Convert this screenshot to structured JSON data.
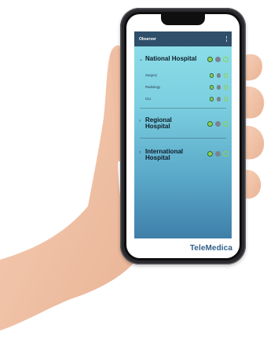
{
  "app": {
    "title": "Observer",
    "brand": "TeleMedica",
    "colors": {
      "header": "#2f4f6a",
      "ok": "#8fd24a",
      "neutral": "#7a8290",
      "brand": "#2f5f8a"
    }
  },
  "groups": [
    {
      "name": "National Hospital",
      "expanded": true,
      "chevron": "⌄",
      "status": [
        "green",
        "gray",
        "hollow"
      ],
      "children": [
        {
          "name": "Surgery",
          "status": [
            "green",
            "gray",
            "hollow"
          ]
        },
        {
          "name": "Radiology",
          "status": [
            "green",
            "gray",
            "hollow"
          ]
        },
        {
          "name": "ICU",
          "status": [
            "green",
            "gray",
            "hollow"
          ]
        }
      ]
    },
    {
      "name": "Regional Hospital",
      "line1": "Regional",
      "line2": "Hospital",
      "expanded": false,
      "chevron": "›",
      "status": [
        "green",
        "gray",
        "hollow"
      ]
    },
    {
      "name": "International Hospital",
      "line1": "International",
      "line2": "Hospital",
      "expanded": false,
      "chevron": "›",
      "status": [
        "green",
        "gray",
        "hollow"
      ]
    }
  ],
  "icons": {
    "menu": "more-vert-icon",
    "expand": "chevron-down-icon",
    "collapsed": "chevron-right-icon"
  }
}
